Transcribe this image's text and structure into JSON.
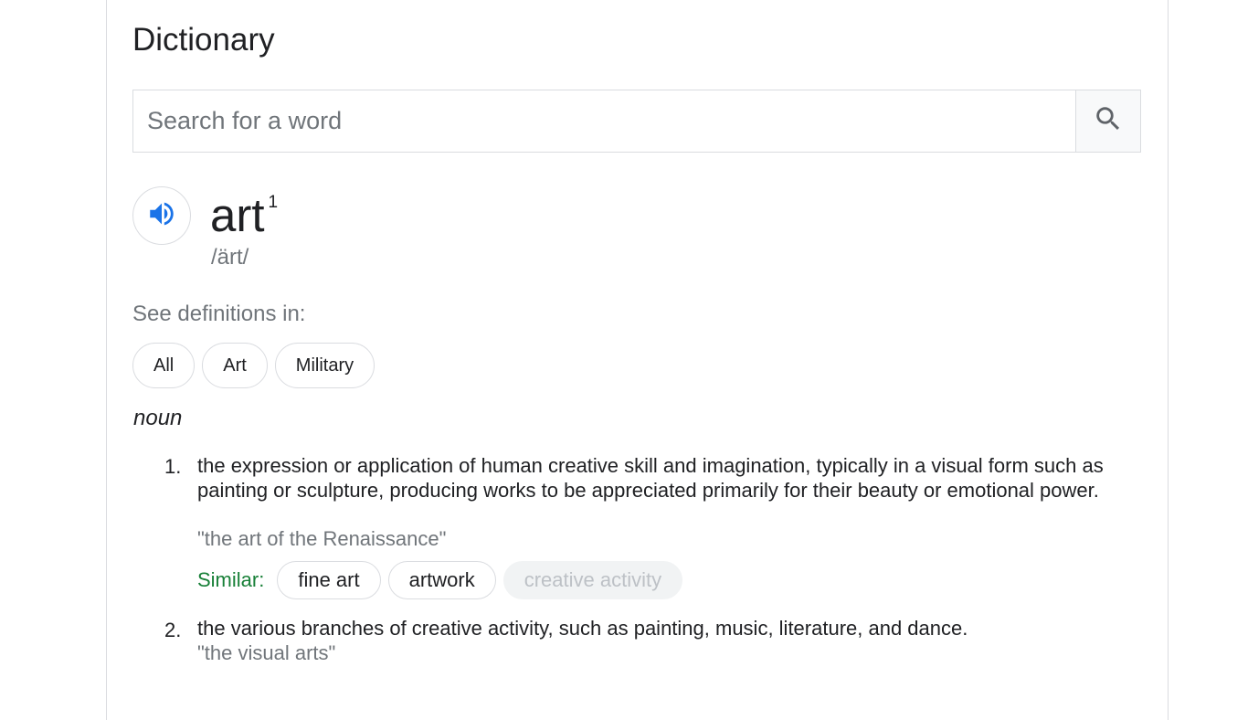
{
  "header": {
    "title": "Dictionary"
  },
  "search": {
    "placeholder": "Search for a word",
    "value": ""
  },
  "entry": {
    "word": "art",
    "superscript": "1",
    "phonetic": "/ärt/"
  },
  "see_definitions": {
    "label": "See definitions in:",
    "chips": [
      "All",
      "Art",
      "Military"
    ]
  },
  "part_of_speech": "noun",
  "definitions": [
    {
      "number": "1.",
      "text": "the expression or application of human creative skill and imagination, typically in a visual form such as painting or sculpture, producing works to be appreciated primarily for their beauty or emotional power.",
      "example": "\"the art of the Renaissance\"",
      "similar_label": "Similar:",
      "similar": [
        "fine art",
        "artwork",
        "creative activity"
      ]
    },
    {
      "number": "2.",
      "text": "the various branches of creative activity, such as painting, music, literature, and dance.",
      "example": "\"the visual arts\""
    }
  ],
  "icons": {
    "search": "search-icon",
    "audio": "speaker-icon"
  },
  "colors": {
    "accent_blue": "#1a73e8",
    "similar_green": "#188038",
    "secondary_text": "#70757a",
    "border": "#dadce0"
  }
}
